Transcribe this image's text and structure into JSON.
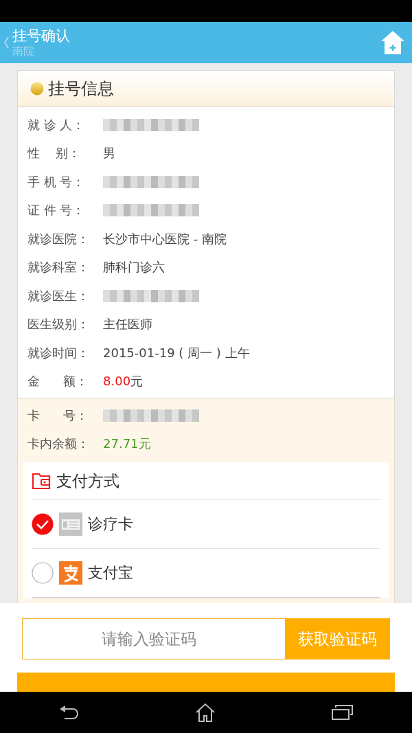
{
  "header": {
    "title": "挂号确认",
    "subtitle": "南院"
  },
  "info_card": {
    "title": "挂号信息",
    "rows": [
      {
        "label": "就 诊 人：",
        "kind": "redacted"
      },
      {
        "label": "性    别：",
        "kind": "text",
        "value": "男"
      },
      {
        "label": "手 机 号：",
        "kind": "redacted"
      },
      {
        "label": "证 件 号：",
        "kind": "redacted"
      },
      {
        "label": "就诊医院：",
        "kind": "text",
        "value": "长沙市中心医院 - 南院"
      },
      {
        "label": "就诊科室：",
        "kind": "text",
        "value": "肺科门诊六"
      },
      {
        "label": "就诊医生：",
        "kind": "redacted"
      },
      {
        "label": "医生级别：",
        "kind": "text",
        "value": "主任医师"
      },
      {
        "label": "就诊时间：",
        "kind": "text",
        "value": "2015-01-19 ( 周一 ) 上午"
      },
      {
        "label": "金      额：",
        "kind": "amount",
        "value": "8.00",
        "unit": "元"
      }
    ]
  },
  "card_rows": [
    {
      "label": "卡      号：",
      "kind": "redacted"
    },
    {
      "label": "卡内余额：",
      "kind": "balance",
      "value": "27.71元"
    }
  ],
  "payment": {
    "title": "支付方式",
    "options": [
      {
        "label": "诊疗卡",
        "kind": "card",
        "selected": true
      },
      {
        "label": "支付宝",
        "kind": "alipay",
        "selected": false
      }
    ]
  },
  "verify": {
    "placeholder": "请输入验证码",
    "button": "获取验证码"
  }
}
